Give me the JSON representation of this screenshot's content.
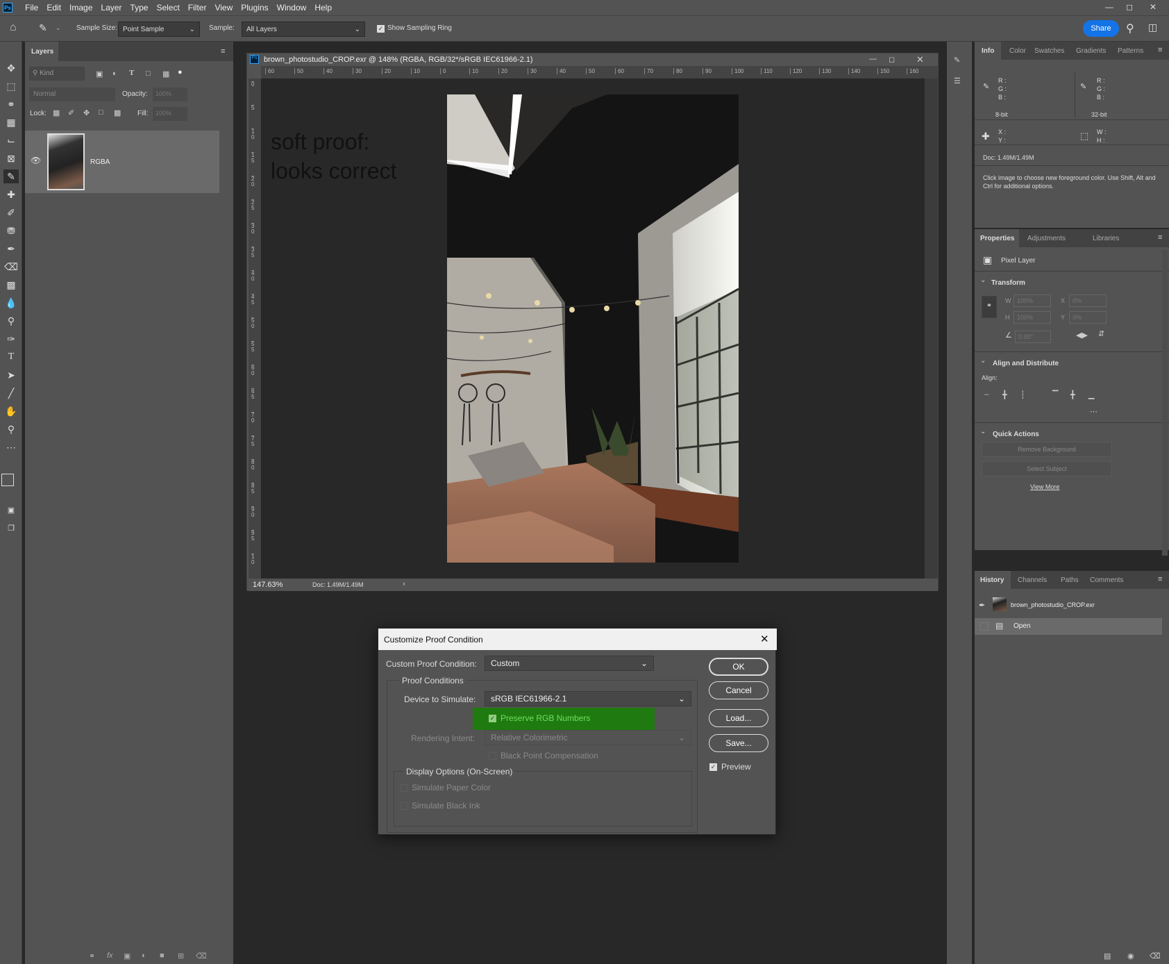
{
  "menubar": {
    "app_icon": "Ps",
    "items": [
      "File",
      "Edit",
      "Image",
      "Layer",
      "Type",
      "Select",
      "Filter",
      "View",
      "Plugins",
      "Window",
      "Help"
    ]
  },
  "options": {
    "sample_size_label": "Sample Size:",
    "sample_size_value": "Point Sample",
    "sample_label": "Sample:",
    "sample_value": "All Layers",
    "sampling_ring_label": "Show Sampling Ring",
    "sampling_ring_checked": true,
    "share_label": "Share"
  },
  "layers": {
    "tab": "Layers",
    "kind_placeholder": "Kind",
    "blend_mode": "Normal",
    "opacity_label": "Opacity:",
    "opacity_value": "100%",
    "lock_label": "Lock:",
    "fill_label": "Fill:",
    "fill_value": "100%",
    "layer_name": "RGBA"
  },
  "document": {
    "title": "brown_photostudio_CROP.exr @ 148% (RGBA, RGB/32*/sRGB IEC61966-2.1)",
    "ruler_top": [
      "60",
      "50",
      "40",
      "30",
      "20",
      "10",
      "0",
      "10",
      "20",
      "30",
      "40",
      "50",
      "60",
      "70",
      "80",
      "90",
      "100",
      "110",
      "120",
      "130",
      "140",
      "150",
      "160"
    ],
    "ruler_left": [
      "0",
      "5",
      "1\n0",
      "1\n5",
      "2\n0",
      "2\n5",
      "3\n0",
      "3\n5",
      "4\n0",
      "4\n5",
      "5\n0",
      "5\n5",
      "6\n0",
      "6\n5",
      "7\n0",
      "7\n5",
      "8\n0",
      "8\n5",
      "9\n0",
      "9\n5",
      "1\n0"
    ],
    "annotation_line1": "soft proof:",
    "annotation_line2": "looks correct",
    "zoom": "147.63%",
    "doc_size": "Doc: 1.49M/1.49M"
  },
  "info_panel": {
    "tabs": [
      "Info",
      "Color",
      "Swatches",
      "Gradients",
      "Patterns"
    ],
    "rgb_labels": [
      "R :",
      "G :",
      "B :"
    ],
    "bit_left": "8-bit",
    "bit_right": "32-bit",
    "xy_labels": [
      "X :",
      "Y :"
    ],
    "wh_labels": [
      "W :",
      "H :"
    ],
    "doc_size": "Doc: 1.49M/1.49M",
    "hint": "Click image to choose new foreground color.  Use Shift, Alt and Ctrl for additional options."
  },
  "properties": {
    "tabs": [
      "Properties",
      "Adjustments",
      "Libraries"
    ],
    "layer_type": "Pixel Layer",
    "transform_title": "Transform",
    "w_label": "W",
    "w_value": "100%",
    "h_label": "H",
    "h_value": "100%",
    "x_label": "X",
    "x_value": "0%",
    "y_label": "Y",
    "y_value": "0%",
    "angle_value": "0.00°",
    "align_title": "Align and Distribute",
    "align_label": "Align:",
    "quick_actions_title": "Quick Actions",
    "remove_bg": "Remove Background",
    "select_subject": "Select Subject",
    "view_more": "View More"
  },
  "history": {
    "tabs": [
      "History",
      "Channels",
      "Paths",
      "Comments"
    ],
    "snapshot": "brown_photostudio_CROP.exr",
    "step": "Open"
  },
  "dialog": {
    "title": "Customize Proof Condition",
    "custom_label": "Custom Proof Condition:",
    "custom_value": "Custom",
    "proof_conditions": "Proof Conditions",
    "device_label": "Device to Simulate:",
    "device_value": "sRGB IEC61966-2.1",
    "preserve_label": "Preserve RGB Numbers",
    "preserve_checked": true,
    "intent_label": "Rendering Intent:",
    "intent_value": "Relative Colorimetric",
    "bpc_label": "Black Point Compensation",
    "display_options": "Display Options (On-Screen)",
    "paper_color": "Simulate Paper Color",
    "black_ink": "Simulate Black Ink",
    "ok": "OK",
    "cancel": "Cancel",
    "load": "Load...",
    "save": "Save...",
    "preview_label": "Preview",
    "preview_checked": true,
    "highlight_color": "#1f7a0f"
  }
}
